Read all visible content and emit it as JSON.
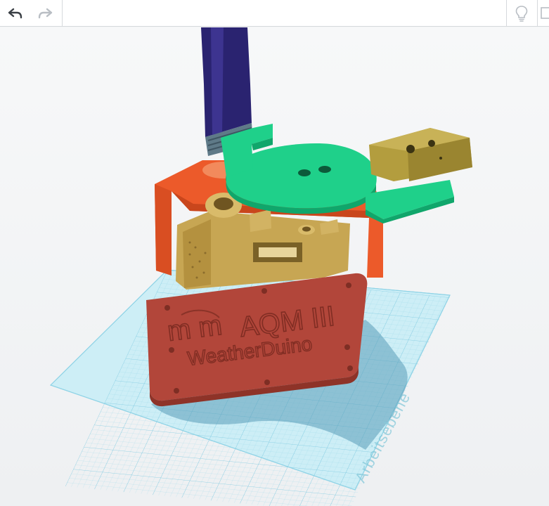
{
  "toolbar": {
    "undo_icon": "undo-arrow-icon",
    "redo_icon": "redo-arrow-icon",
    "hint_icon": "lightbulb-icon"
  },
  "viewport": {
    "workplane_label": "Arbeitsebene",
    "face_plate": {
      "title": "AQM III",
      "subtitle": "WeatherDuino",
      "logo_glyph": "m m"
    }
  },
  "colors": {
    "workplane_grid": "#a8e0ee",
    "housing_orange": "#ec5a2a",
    "frame_tan": "#c7a653",
    "plate_green": "#1fd08a",
    "bracket_olive": "#b39d3e",
    "tube_navy": "#2a2370",
    "face_plate_red": "#b2463a"
  }
}
